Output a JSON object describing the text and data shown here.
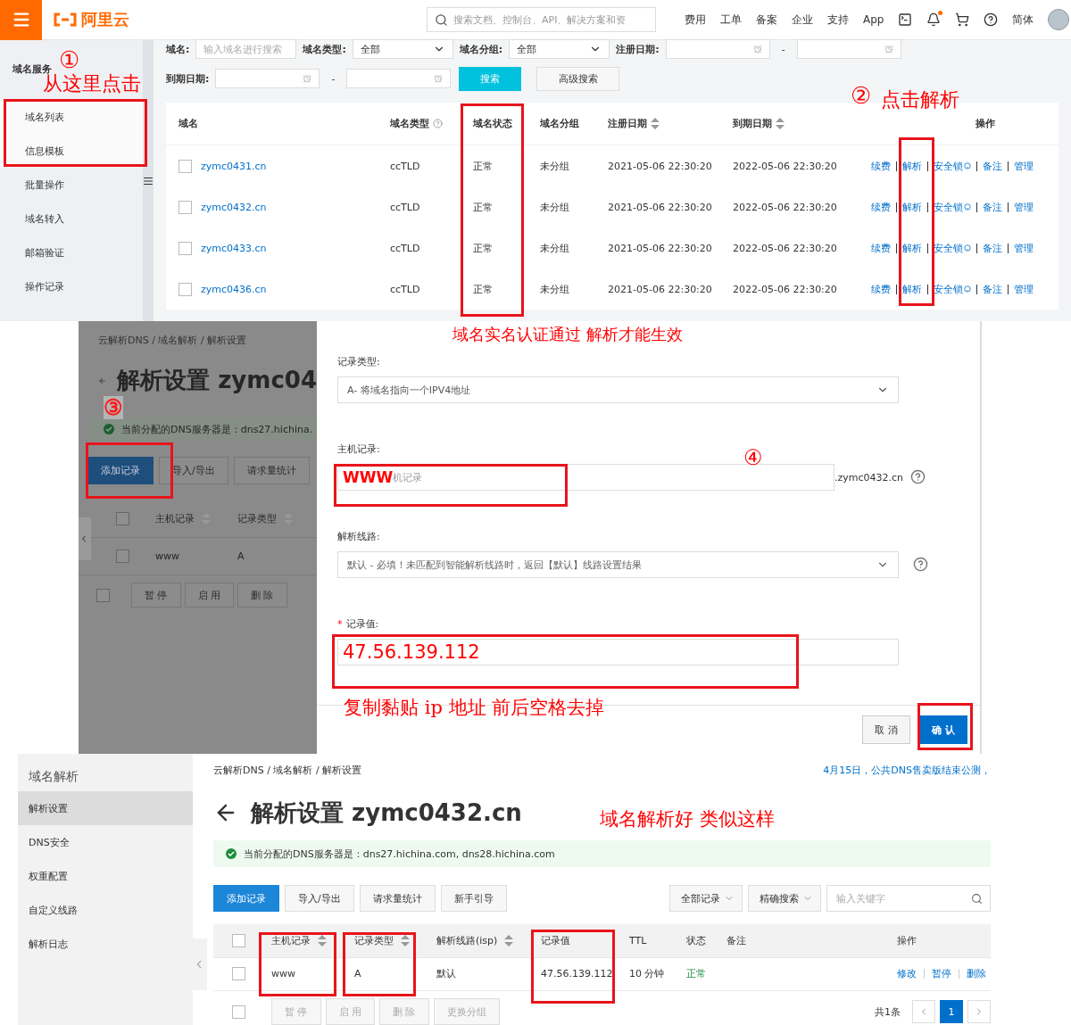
{
  "domain_console": {
    "topbar": {
      "logo": "阿里云",
      "search": {
        "placeholder": "搜索文档、控制台、API、解决方案和资"
      },
      "nav": [
        "费用",
        "工单",
        "备案",
        "企业",
        "支持",
        "App"
      ],
      "notification_dot": true,
      "language": "简体"
    },
    "sidebar": {
      "title": "域名服务",
      "items": [
        {
          "label": "域名列表",
          "kind": "sub"
        },
        {
          "label": "信息模板",
          "kind": "sub"
        },
        {
          "label": "批量操作",
          "kind": "main"
        },
        {
          "label": "域名转入",
          "kind": "main"
        },
        {
          "label": "邮箱验证",
          "kind": "main"
        },
        {
          "label": "操作记录",
          "kind": "main"
        }
      ]
    },
    "filters": {
      "name": {
        "label": "域名:",
        "placeholder": "输入域名进行搜索"
      },
      "type": {
        "label": "域名类型:",
        "value": "全部"
      },
      "group": {
        "label": "域名分组:",
        "value": "全部"
      },
      "reg_date": {
        "label": "注册日期:",
        "separator": "-"
      },
      "exp_date": {
        "label": "到期日期:",
        "separator": "-"
      },
      "buttons": [
        "搜索",
        "高级搜索"
      ]
    },
    "table": {
      "columns": [
        {
          "label": "域名",
          "help": false,
          "sortable": false
        },
        {
          "label": "域名类型",
          "help": true,
          "sortable": false
        },
        {
          "label": "域名状态",
          "help": false,
          "sortable": false
        },
        {
          "label": "域名分组",
          "help": false,
          "sortable": false
        },
        {
          "label": "注册日期",
          "help": false,
          "sortable": true
        },
        {
          "label": "到期日期",
          "help": false,
          "sortable": true
        },
        {
          "label": "操作",
          "help": false,
          "sortable": false
        }
      ],
      "rows": [
        {
          "checked": false,
          "domain": "zymc0431.cn",
          "type": "ccTLD",
          "status": "正常",
          "group": "未分组",
          "registered": "2021-05-06 22:30:20",
          "expires": "2022-05-06 22:30:20",
          "actions": [
            "续费",
            "解析",
            "安全锁",
            "备注",
            "管理"
          ]
        },
        {
          "checked": false,
          "domain": "zymc0432.cn",
          "type": "ccTLD",
          "status": "正常",
          "group": "未分组",
          "registered": "2021-05-06 22:30:20",
          "expires": "2022-05-06 22:30:20",
          "actions": [
            "续费",
            "解析",
            "安全锁",
            "备注",
            "管理"
          ]
        },
        {
          "checked": false,
          "domain": "zymc0433.cn",
          "type": "ccTLD",
          "status": "正常",
          "group": "未分组",
          "registered": "2021-05-06 22:30:20",
          "expires": "2022-05-06 22:30:20",
          "actions": [
            "续费",
            "解析",
            "安全锁",
            "备注",
            "管理"
          ]
        },
        {
          "checked": false,
          "domain": "zymc0436.cn",
          "type": "ccTLD",
          "status": "正常",
          "group": "未分组",
          "registered": "2021-05-06 22:30:20",
          "expires": "2022-05-06 22:30:20",
          "actions": [
            "续费",
            "解析",
            "安全锁",
            "备注",
            "管理"
          ]
        }
      ]
    },
    "annotations": [
      "①",
      "从这里点击",
      "②",
      "点击解析"
    ]
  },
  "record_dialog": {
    "background_page": {
      "breadcrumb": "云解析DNS / 域名解析 / 解析设置",
      "title": "解析设置 zymc04",
      "notice": "当前分配的DNS服务器是：dns27.hichina.",
      "buttons": [
        "添加记录",
        "导入/导出",
        "请求量统计"
      ],
      "header_checked": false,
      "columns": [
        "主机记录",
        "记录类型"
      ],
      "row": {
        "checked": false,
        "host": "www",
        "type": "A"
      },
      "bulk_checked": false,
      "bulk_buttons": [
        "暂 停",
        "启 用",
        "删 除"
      ]
    },
    "form": {
      "record_type": {
        "label": "记录类型:",
        "value": "A- 将域名指向一个IPV4地址"
      },
      "host": {
        "label": "主机记录:",
        "placeholder": "机记录",
        "suffix": ".zymc0432.cn"
      },
      "line": {
        "label": "解析线路:",
        "value": "默认 - 必填！未匹配到智能解析线路时，返回【默认】线路设置结果"
      },
      "value": {
        "required_mark": "*",
        "label": "记录值:"
      },
      "buttons": [
        "取 消",
        "确 认"
      ]
    },
    "annotations": [
      "域名实名认证通过 解析才能生效",
      "③",
      "WWW",
      "④",
      "47.56.139.112",
      "复制黏贴 ip 地址 前后空格去掉"
    ]
  },
  "result_page": {
    "sidebar": {
      "title": "域名解析",
      "items": [
        {
          "label": "解析设置",
          "selected": true
        },
        {
          "label": "DNS安全",
          "selected": false
        },
        {
          "label": "权重配置",
          "selected": false
        },
        {
          "label": "自定义线路",
          "selected": false
        },
        {
          "label": "解析日志",
          "selected": false
        }
      ]
    },
    "breadcrumb": "云解析DNS / 域名解析 / 解析设置",
    "announcement": "4月15日，公共DNS售卖版结束公测，",
    "title": "解析设置 zymc0432.cn",
    "notice": "当前分配的DNS服务器是：dns27.hichina.com, dns28.hichina.com",
    "toolbar": {
      "buttons": [
        "添加记录",
        "导入/导出",
        "请求量统计",
        "新手引导"
      ],
      "filters": [
        "全部记录",
        "精确搜索"
      ],
      "search": {
        "placeholder": "输入关键字"
      }
    },
    "table": {
      "header_checked": false,
      "columns": [
        {
          "label": "主机记录",
          "sortable": true
        },
        {
          "label": "记录类型",
          "sortable": true
        },
        {
          "label": "解析线路(isp)",
          "sortable": true
        },
        {
          "label": "记录值",
          "sortable": false
        },
        {
          "label": "TTL",
          "sortable": false
        },
        {
          "label": "状态",
          "sortable": false
        },
        {
          "label": "备注",
          "sortable": false
        },
        {
          "label": "操作",
          "sortable": false
        }
      ],
      "rows": [
        {
          "checked": false,
          "host": "www",
          "type": "A",
          "line": "默认",
          "value": "47.56.139.112",
          "ttl": "10 分钟",
          "status": "正常",
          "actions": [
            "修改",
            "暂停",
            "删除"
          ]
        }
      ]
    },
    "bulk_checked": false,
    "bulk_buttons": [
      "暂 停",
      "启 用",
      "删 除",
      "更换分组"
    ],
    "total": "共1条",
    "pages": [
      {
        "label": "1",
        "selected": true
      }
    ],
    "annotations": [
      "域名解析好 类似这样"
    ]
  }
}
